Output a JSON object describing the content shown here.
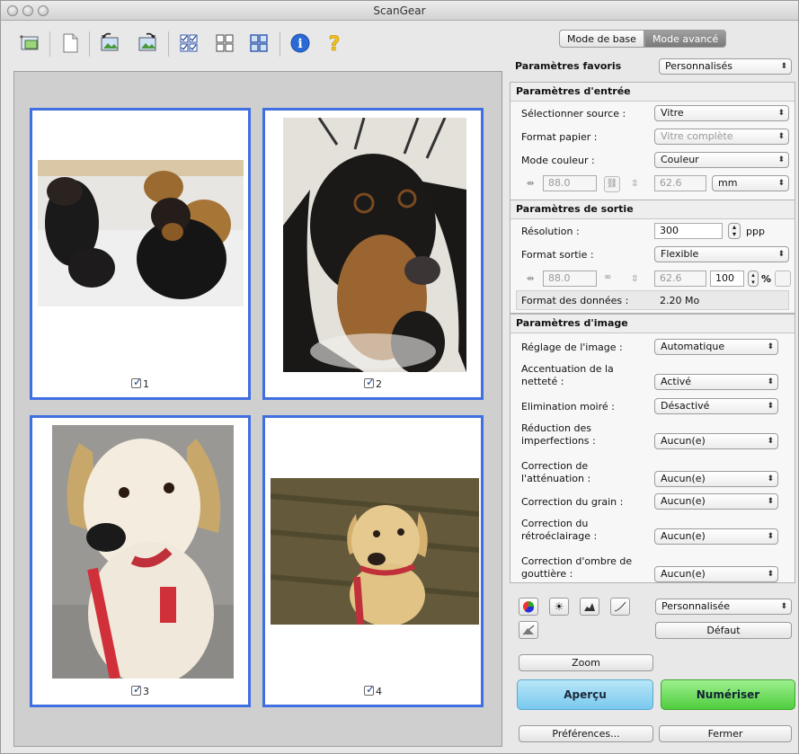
{
  "window": {
    "title": "ScanGear"
  },
  "tabs": {
    "basic": "Mode de base",
    "advanced": "Mode avancé"
  },
  "favorites": {
    "label": "Paramètres favoris",
    "value": "Personnalisés"
  },
  "input": {
    "header": "Paramètres d'entrée",
    "source_label": "Sélectionner source :",
    "source_value": "Vitre",
    "paper_label": "Format papier :",
    "paper_value": "Vitre complète",
    "color_label": "Mode couleur :",
    "color_value": "Couleur",
    "width": "88.0",
    "height": "62.6",
    "unit": "mm"
  },
  "output": {
    "header": "Paramètres de sortie",
    "resolution_label": "Résolution :",
    "resolution_value": "300",
    "resolution_unit": "ppp",
    "size_label": "Format sortie :",
    "size_value": "Flexible",
    "width": "88.0",
    "height": "62.6",
    "scale": "100",
    "scale_unit": "%",
    "datasize_label": "Format des données :",
    "datasize_value": "2.20 Mo"
  },
  "image": {
    "header": "Paramètres d'image",
    "rows": [
      {
        "l1": "Réglage de l'image :",
        "l2": "",
        "value": "Automatique"
      },
      {
        "l1": "Accentuation de la",
        "l2": "netteté :",
        "value": "Activé"
      },
      {
        "l1": "Elimination moiré :",
        "l2": "",
        "value": "Désactivé"
      },
      {
        "l1": "Réduction des",
        "l2": "imperfections :",
        "value": "Aucun(e)"
      },
      {
        "l1": "Correction de",
        "l2": "l'atténuation :",
        "value": "Aucun(e)"
      },
      {
        "l1": "Correction du grain :",
        "l2": "",
        "value": "Aucun(e)"
      },
      {
        "l1": "Correction du",
        "l2": "rétroéclairage :",
        "value": "Aucun(e)"
      },
      {
        "l1": "Correction d'ombre de",
        "l2": "gouttière :",
        "value": "Aucun(e)"
      }
    ]
  },
  "tone": {
    "preset": "Personnalisée",
    "default_button": "Défaut"
  },
  "buttons": {
    "zoom": "Zoom",
    "preview": "Aperçu",
    "scan": "Numériser",
    "preferences": "Préférences...",
    "close": "Fermer"
  },
  "thumbnails": [
    {
      "label": "1"
    },
    {
      "label": "2"
    },
    {
      "label": "3"
    },
    {
      "label": "4"
    }
  ],
  "colors": {
    "selection_border": "#3f6fe0",
    "preview_button": "#8fd3f0",
    "scan_button": "#6cdb5e"
  }
}
